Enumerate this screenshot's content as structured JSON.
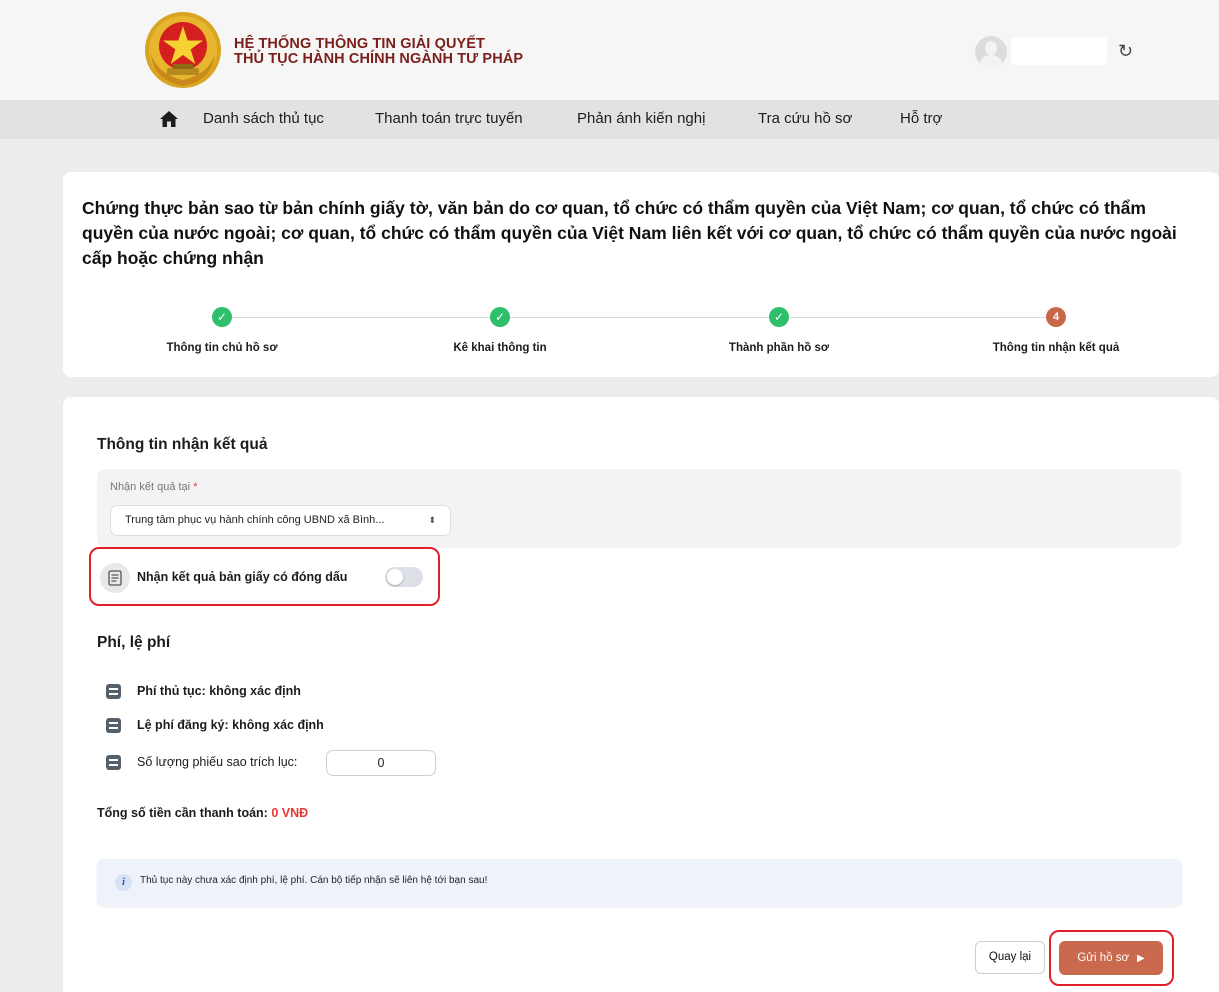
{
  "header": {
    "title_line1": "HỆ THỐNG THÔNG TIN GIẢI QUYẾT",
    "title_line2": "THỦ TỤC HÀNH CHÍNH NGÀNH TƯ PHÁP",
    "refresh_icon": "refresh-icon",
    "brand_color": "#7a1f1a"
  },
  "nav": {
    "home_icon": "home-icon",
    "items": [
      {
        "label": "Danh sách thủ tục"
      },
      {
        "label": "Thanh toán trực tuyến"
      },
      {
        "label": "Phản ánh kiến nghị"
      },
      {
        "label": "Tra cứu hồ sơ"
      },
      {
        "label": "Hỗ trợ"
      }
    ]
  },
  "procedure": {
    "title": "Chứng thực bản sao từ bản chính giấy tờ, văn bản do cơ quan, tổ chức có thẩm quyền của Việt Nam; cơ quan, tổ chức có thẩm quyền của nước ngoài; cơ quan, tổ chức có thẩm quyền của Việt Nam liên kết với cơ quan, tổ chức có thẩm quyền của nước ngoài cấp hoặc chứng nhận"
  },
  "steps": [
    {
      "label": "Thông tin chủ hồ sơ",
      "status": "done",
      "mark": "✓"
    },
    {
      "label": "Kê khai thông tin",
      "status": "done",
      "mark": "✓"
    },
    {
      "label": "Thành phần hồ sơ",
      "status": "done",
      "mark": "✓"
    },
    {
      "label": "Thông tin nhận kết quả",
      "status": "current",
      "mark": "4"
    }
  ],
  "result": {
    "section_title": "Thông tin nhận kết quả",
    "receive_at_label": "Nhận kết quả tại",
    "required_mark": "*",
    "receive_at_value": "Trung tâm phục vụ hành chính công UBND xã Bình...",
    "select_arrows": "⬍",
    "paper_toggle_label": "Nhận kết quả bản giấy có đóng dấu",
    "paper_toggle_on": false
  },
  "fees": {
    "section_title": "Phí, lệ phí",
    "procedure_fee": "Phí thủ tục: không xác định",
    "registration_fee": "Lệ phí đăng ký: không xác định",
    "copies_label": "Số lượng phiếu sao trích lục:",
    "copies_value": "0",
    "total_label": "Tổng số tiền cần thanh toán:",
    "total_value": "0 VNĐ",
    "total_color": "#e53935"
  },
  "info": {
    "icon": "i",
    "text": "Thủ tục này chưa xác định phí, lệ phí. Cán bộ tiếp nhận sẽ liên hệ tới bạn sau!"
  },
  "actions": {
    "back_label": "Quay lại",
    "submit_label": "Gửi hồ sơ",
    "submit_icon": "send-icon",
    "submit_arrow": "▶",
    "accent": "#c96a4e"
  }
}
